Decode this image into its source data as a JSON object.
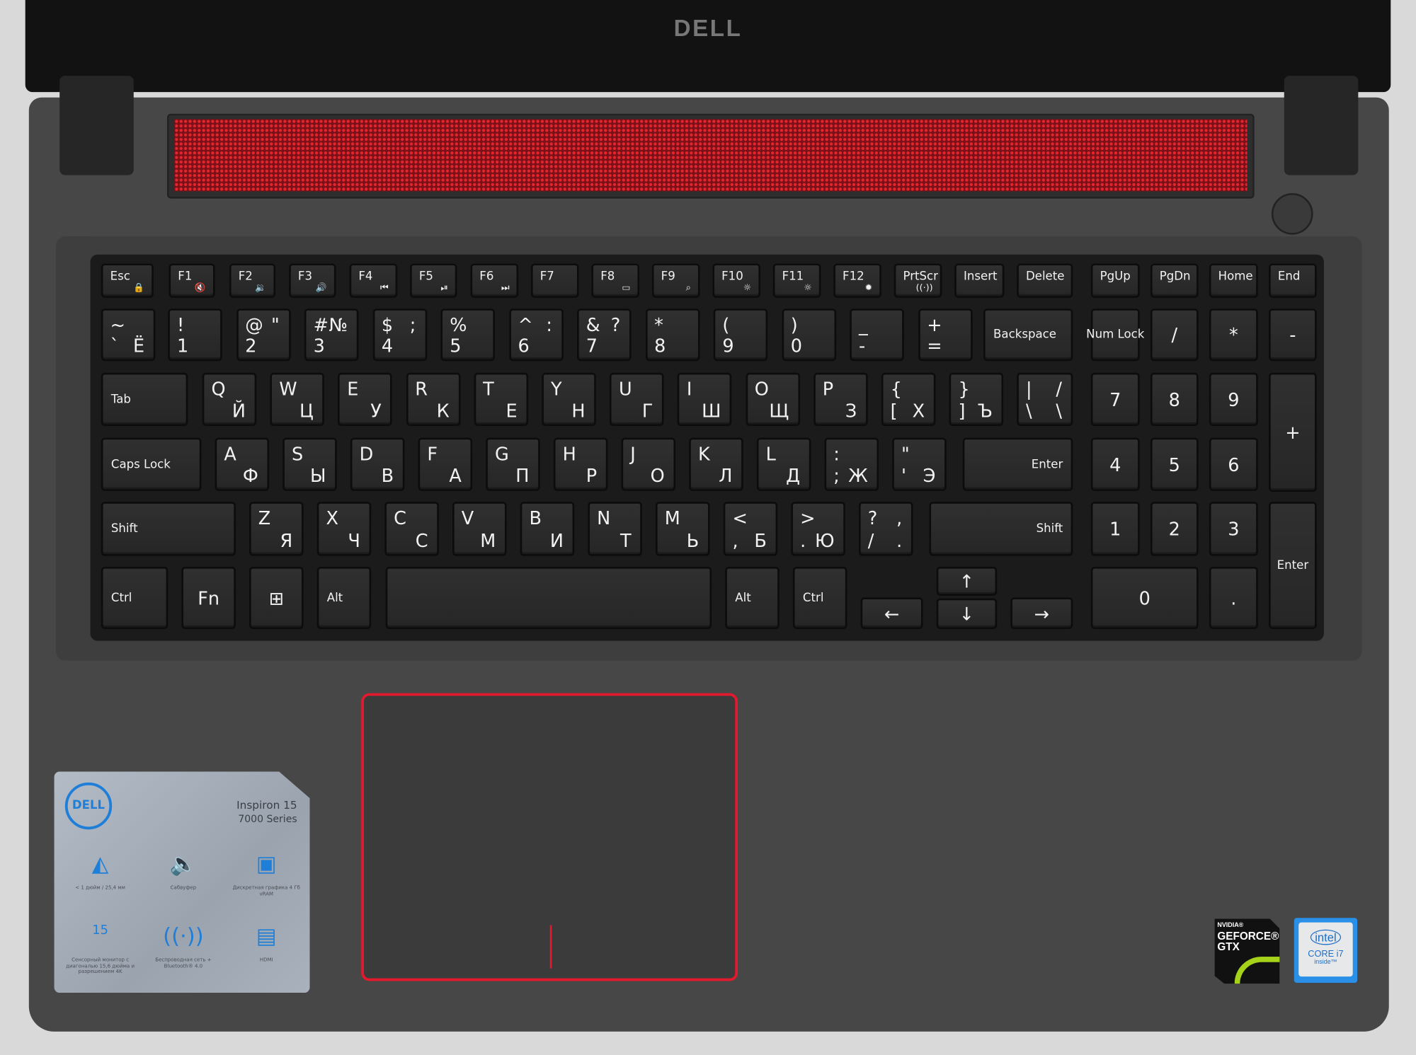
{
  "brand_logo": "DELL",
  "keys": [
    {
      "a": "Esc",
      "icon": "lock-icon",
      "g": "🔒"
    },
    {
      "a": "F1",
      "icon": "mute-icon",
      "g": "🔇"
    },
    {
      "a": "F2",
      "icon": "volume-down-icon",
      "g": "🔉"
    },
    {
      "a": "F3",
      "icon": "volume-up-icon",
      "g": "🔊"
    },
    {
      "a": "F4",
      "icon": "previous-track-icon",
      "g": "⏮"
    },
    {
      "a": "F5",
      "icon": "play-pause-icon",
      "g": "⏯"
    },
    {
      "a": "F6",
      "icon": "next-track-icon",
      "g": "⏭"
    },
    {
      "a": "F7"
    },
    {
      "a": "F8",
      "icon": "display-switch-icon",
      "g": "▭"
    },
    {
      "a": "F9",
      "icon": "search-icon",
      "g": "⌕"
    },
    {
      "a": "F10",
      "icon": "keyboard-backlight-icon",
      "g": "☼"
    },
    {
      "a": "F11",
      "icon": "brightness-down-icon",
      "g": "☼"
    },
    {
      "a": "F12",
      "icon": "brightness-up-icon",
      "g": "✹"
    },
    {
      "a": "PrtScr",
      "icon": "wireless-icon",
      "g": "((·))"
    },
    {
      "a": "Insert"
    },
    {
      "a": "Delete"
    },
    {
      "a": "PgUp"
    },
    {
      "a": "PgDn"
    },
    {
      "a": "Home"
    },
    {
      "a": "End"
    },
    {
      "a": "~",
      "c": "`",
      "d": "Ё"
    },
    {
      "a": "!",
      "c": "1"
    },
    {
      "a": "@",
      "b": "\"",
      "c": "2"
    },
    {
      "a": "#",
      "b": "№",
      "c": "3"
    },
    {
      "a": "$",
      "b": ";",
      "c": "4"
    },
    {
      "a": "%",
      "c": "5"
    },
    {
      "a": "^",
      "b": ":",
      "c": "6"
    },
    {
      "a": "&",
      "b": "?",
      "c": "7"
    },
    {
      "a": "*",
      "c": "8"
    },
    {
      "a": "(",
      "c": "9"
    },
    {
      "a": ")",
      "c": "0"
    },
    {
      "a": "_",
      "c": "-"
    },
    {
      "a": "+",
      "c": "="
    },
    {
      "m": "Backspace"
    },
    {
      "m": "Num Lock",
      "icon": "numlock-icon"
    },
    {
      "m": "/"
    },
    {
      "m": "*"
    },
    {
      "m": "-"
    },
    {
      "m": "Tab"
    },
    {
      "a": "Q",
      "d": "Й"
    },
    {
      "a": "W",
      "d": "Ц"
    },
    {
      "a": "E",
      "d": "У"
    },
    {
      "a": "R",
      "d": "К"
    },
    {
      "a": "T",
      "d": "Е"
    },
    {
      "a": "Y",
      "d": "Н"
    },
    {
      "a": "U",
      "d": "Г"
    },
    {
      "a": "I",
      "d": "Ш"
    },
    {
      "a": "O",
      "d": "Щ"
    },
    {
      "a": "P",
      "d": "З"
    },
    {
      "a": "{",
      "c": "[",
      "d": "Х"
    },
    {
      "a": "}",
      "c": "]",
      "d": "Ъ"
    },
    {
      "a": "|",
      "b": "/",
      "c": "\\",
      "d": "\\"
    },
    {
      "m": "7"
    },
    {
      "m": "8"
    },
    {
      "m": "9"
    },
    {
      "m": "+"
    },
    {
      "m": "Caps Lock"
    },
    {
      "a": "A",
      "d": "Ф"
    },
    {
      "a": "S",
      "d": "Ы"
    },
    {
      "a": "D",
      "d": "В"
    },
    {
      "a": "F",
      "d": "А"
    },
    {
      "a": "G",
      "d": "П"
    },
    {
      "a": "H",
      "d": "Р"
    },
    {
      "a": "J",
      "d": "О"
    },
    {
      "a": "K",
      "d": "Л"
    },
    {
      "a": "L",
      "d": "Д"
    },
    {
      "a": ":",
      "c": ";",
      "d": "Ж"
    },
    {
      "a": "\"",
      "c": "'",
      "d": "Э"
    },
    {
      "m": "Enter"
    },
    {
      "m": "4"
    },
    {
      "m": "5"
    },
    {
      "m": "6"
    },
    {
      "m": "Shift"
    },
    {
      "a": "Z",
      "d": "Я"
    },
    {
      "a": "X",
      "d": "Ч"
    },
    {
      "a": "C",
      "d": "С"
    },
    {
      "a": "V",
      "d": "М"
    },
    {
      "a": "B",
      "d": "И"
    },
    {
      "a": "N",
      "d": "Т"
    },
    {
      "a": "M",
      "d": "Ь"
    },
    {
      "a": "<",
      "c": ",",
      "d": "Б"
    },
    {
      "a": ">",
      "c": ".",
      "d": "Ю"
    },
    {
      "a": "?",
      "b": ",",
      "c": "/",
      "d": "."
    },
    {
      "m": "Shift"
    },
    {
      "m": "1"
    },
    {
      "m": "2"
    },
    {
      "m": "3"
    },
    {
      "m": "Enter"
    },
    {
      "m": "Ctrl"
    },
    {
      "m": "Fn"
    },
    {
      "m": "⊞",
      "icon": "windows-icon"
    },
    {
      "m": "Alt"
    },
    {
      "m": ""
    },
    {
      "m": "Alt"
    },
    {
      "m": "Ctrl",
      "icon": "menu-icon"
    },
    {
      "m": "←"
    },
    {
      "m": "↑"
    },
    {
      "m": "↓"
    },
    {
      "m": "→"
    },
    {
      "m": "0"
    },
    {
      "m": "."
    }
  ],
  "sticker": {
    "logo": "DELL",
    "model": "Inspiron 15",
    "series": "7000 Series",
    "features": [
      {
        "icon": "thinness-icon",
        "label": "< 1 дюйм / 25,4 мм"
      },
      {
        "icon": "speaker-icon",
        "label": "Сабвуфер"
      },
      {
        "icon": "graphics-card-icon",
        "label": "Дискретная графика 4 Гб vRAM"
      },
      {
        "icon": "touch-monitor-icon",
        "label": "Сенсорный монитор с диагональю 15,6 дюйма и разрешением 4K",
        "badge": "15"
      },
      {
        "icon": "wifi-icon",
        "label": "Беспроводная сеть + Bluetooth® 4.0"
      },
      {
        "icon": "hdmi-icon",
        "label": "HDMI"
      }
    ]
  },
  "nvidia_badge": {
    "line1": "NVIDIA®",
    "line2": "GEFORCE®",
    "line3": "GTX"
  },
  "intel_badge": {
    "brand": "intel",
    "line1": "CORE i7",
    "line2": "inside™"
  },
  "colors": {
    "accent": "#e3192e",
    "sticker_blue": "#1f7fd8",
    "nvidia_green": "#a6d21a"
  }
}
